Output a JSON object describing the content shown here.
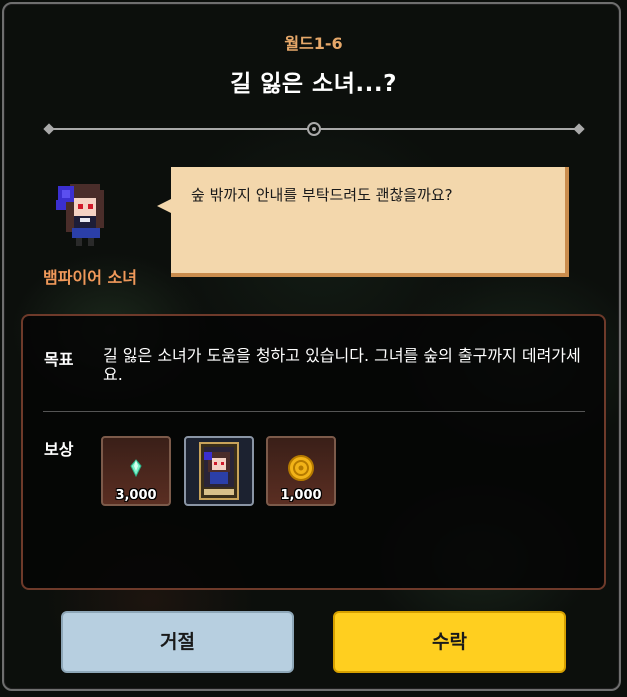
{
  "header": {
    "world_label": "월드1-6",
    "quest_title": "길 잃은 소녀...?"
  },
  "npc": {
    "name": "뱀파이어 소녀",
    "dialogue": "숲 밖까지 안내를 부탁드려도 괜찮을까요?"
  },
  "quest": {
    "goal_label": "목표",
    "goal_text": "길 잃은 소녀가 도움을 청하고 있습니다. 그녀를 숲의 출구까지 데려가세요.",
    "reward_label": "보상",
    "rewards": [
      {
        "type": "gem",
        "amount": "3,000"
      },
      {
        "type": "hero-card",
        "amount": ""
      },
      {
        "type": "gold-coin",
        "amount": "1,000"
      }
    ]
  },
  "buttons": {
    "reject": "거절",
    "accept": "수락"
  },
  "colors": {
    "accept": "#ffcf1f",
    "reject": "#b7cfe0",
    "world_label": "#e6a86a",
    "npc_name": "#f0995a"
  }
}
